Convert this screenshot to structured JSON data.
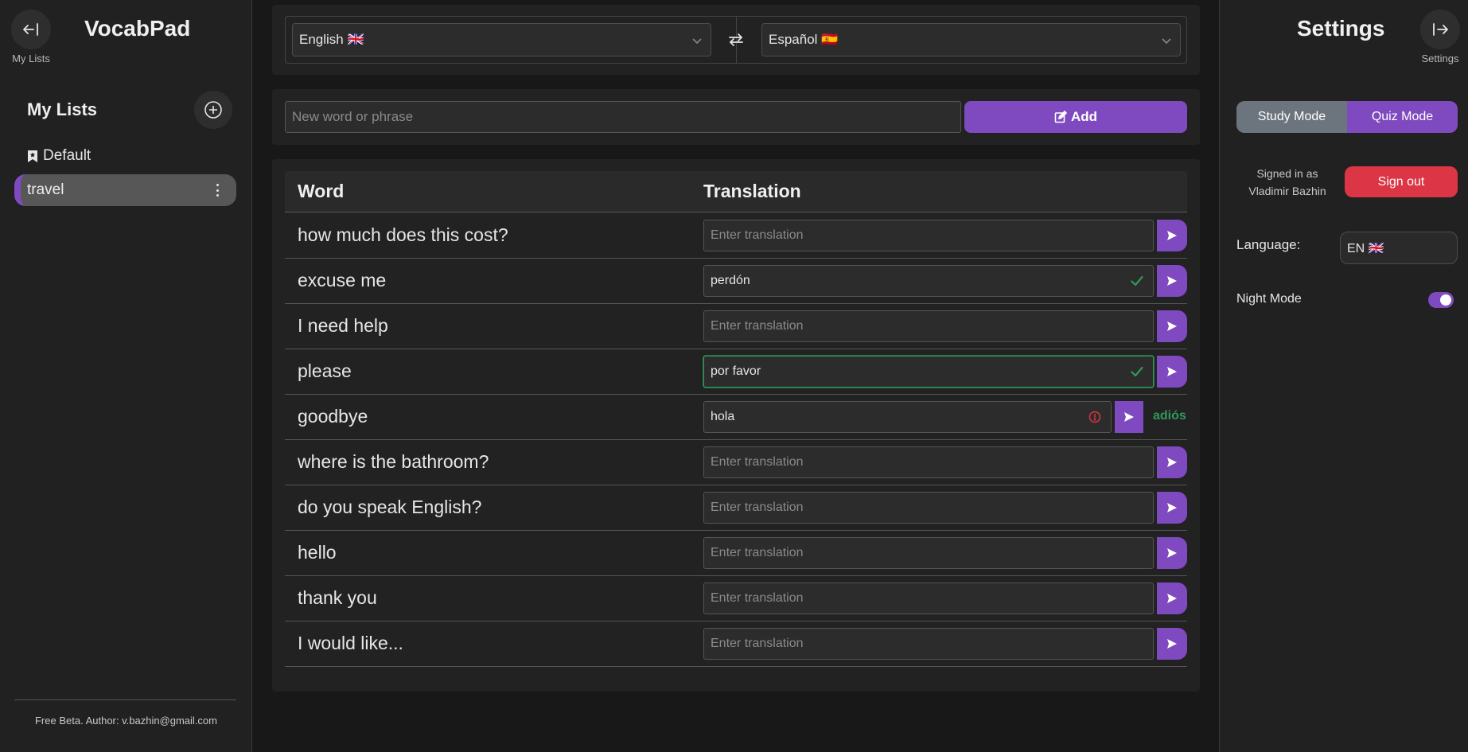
{
  "app": {
    "title": "VocabPad",
    "my_lists_button_label": "My Lists",
    "settings_button_label": "Settings"
  },
  "sidebar": {
    "heading": "My Lists",
    "lists": [
      {
        "label": "Default",
        "icon": "bookmark-icon",
        "active": false
      },
      {
        "label": "travel",
        "active": true
      }
    ],
    "footer": "Free Beta. Author: v.bazhin@gmail.com"
  },
  "languages": {
    "source": "English 🇬🇧",
    "target": "Español 🇪🇸"
  },
  "add_word": {
    "placeholder": "New word or phrase",
    "button_label": "Add"
  },
  "table": {
    "headers": {
      "word": "Word",
      "translation": "Translation"
    },
    "translation_placeholder": "Enter translation",
    "rows": [
      {
        "word": "how much does this cost?",
        "value": "",
        "status": "none"
      },
      {
        "word": "excuse me",
        "value": "perdón",
        "status": "correct"
      },
      {
        "word": "I need help",
        "value": "",
        "status": "none"
      },
      {
        "word": "please",
        "value": "por favor",
        "status": "correct"
      },
      {
        "word": "goodbye",
        "value": "hola",
        "status": "wrong",
        "correct_answer": "adiós"
      },
      {
        "word": "where is the bathroom?",
        "value": "",
        "status": "none"
      },
      {
        "word": "do you speak English?",
        "value": "",
        "status": "none"
      },
      {
        "word": "hello",
        "value": "",
        "status": "none"
      },
      {
        "word": "thank you",
        "value": "",
        "status": "none"
      },
      {
        "word": "I would like...",
        "value": "",
        "status": "none"
      }
    ]
  },
  "settings": {
    "title": "Settings",
    "modes": {
      "study": "Study Mode",
      "quiz": "Quiz Mode",
      "active": "quiz"
    },
    "signed_in_line1": "Signed in as",
    "signed_in_line2": "Vladimir Bazhin",
    "sign_out_label": "Sign out",
    "language_label": "Language:",
    "language_value": "EN 🇬🇧",
    "night_mode_label": "Night Mode",
    "night_mode_on": true
  },
  "colors": {
    "accent": "#7f4ac0",
    "success": "#2f9a5c",
    "danger": "#dc3545",
    "neutral": "#6c757d"
  }
}
